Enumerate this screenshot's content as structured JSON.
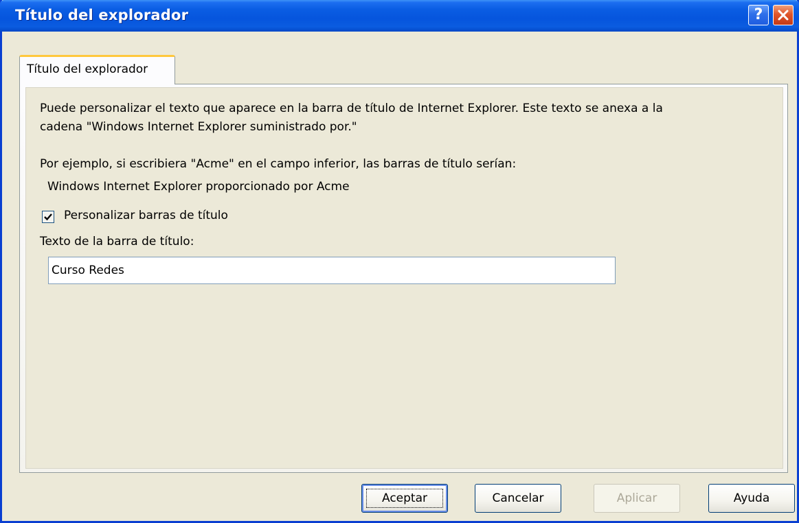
{
  "window": {
    "title": "Título del explorador",
    "help_glyph": "?",
    "close_icon": "close-icon"
  },
  "tab": {
    "label": "Título del explorador"
  },
  "content": {
    "description_line1": "Puede personalizar el texto que aparece en la barra de título de Internet Explorer. Este texto se anexa a la",
    "description_line2": "cadena \"Windows Internet Explorer suministrado por.\"",
    "example_intro": "Por ejemplo, si escribiera \"Acme\" en el campo inferior, las barras de título serían:",
    "example_result": "Windows Internet Explorer proporcionado por Acme",
    "checkbox_label": "Personalizar barras de título",
    "checkbox_checked": true,
    "field_label": "Texto de la barra de título:",
    "field_value": "Curso Redes"
  },
  "buttons": {
    "ok": "Aceptar",
    "cancel": "Cancelar",
    "apply": "Aplicar",
    "help": "Ayuda"
  },
  "colors": {
    "titlebar": "#0655dd",
    "dialog_bg": "#ece9d8",
    "tab_highlight": "#ffc83c"
  }
}
